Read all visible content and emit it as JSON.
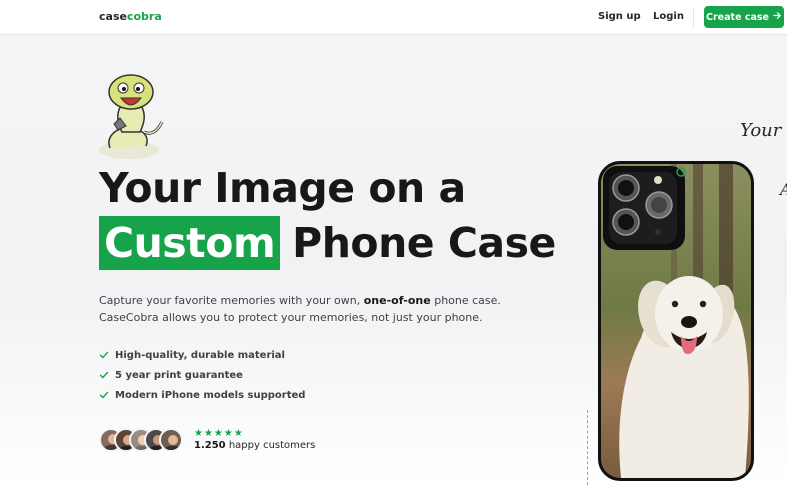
{
  "nav": {
    "logo_main": "case",
    "logo_accent": "cobra",
    "signup": "Sign up",
    "login": "Login",
    "create": "Create case",
    "create_icon": "arrow-right-icon"
  },
  "hero": {
    "headline_line1": "Your Image on a",
    "headline_highlight": "Custom",
    "headline_rest": "Phone Case",
    "desc_start": "Capture your favorite memories with your own, ",
    "desc_bold": "one-of-one",
    "desc_end": " phone case. CaseCobra allows you to protect your memories, not just your phone.",
    "features": [
      "High-quality, durable material",
      "5 year print guarantee",
      "Modern iPhone models supported"
    ],
    "stars": "★★★★★",
    "rating": 5,
    "customers_count": "1.250",
    "customers_label": " happy customers"
  },
  "side": {
    "handwritten": "Your",
    "handwritten2": "A"
  },
  "colors": {
    "brand": "#16a34a",
    "text": "#18181b"
  }
}
